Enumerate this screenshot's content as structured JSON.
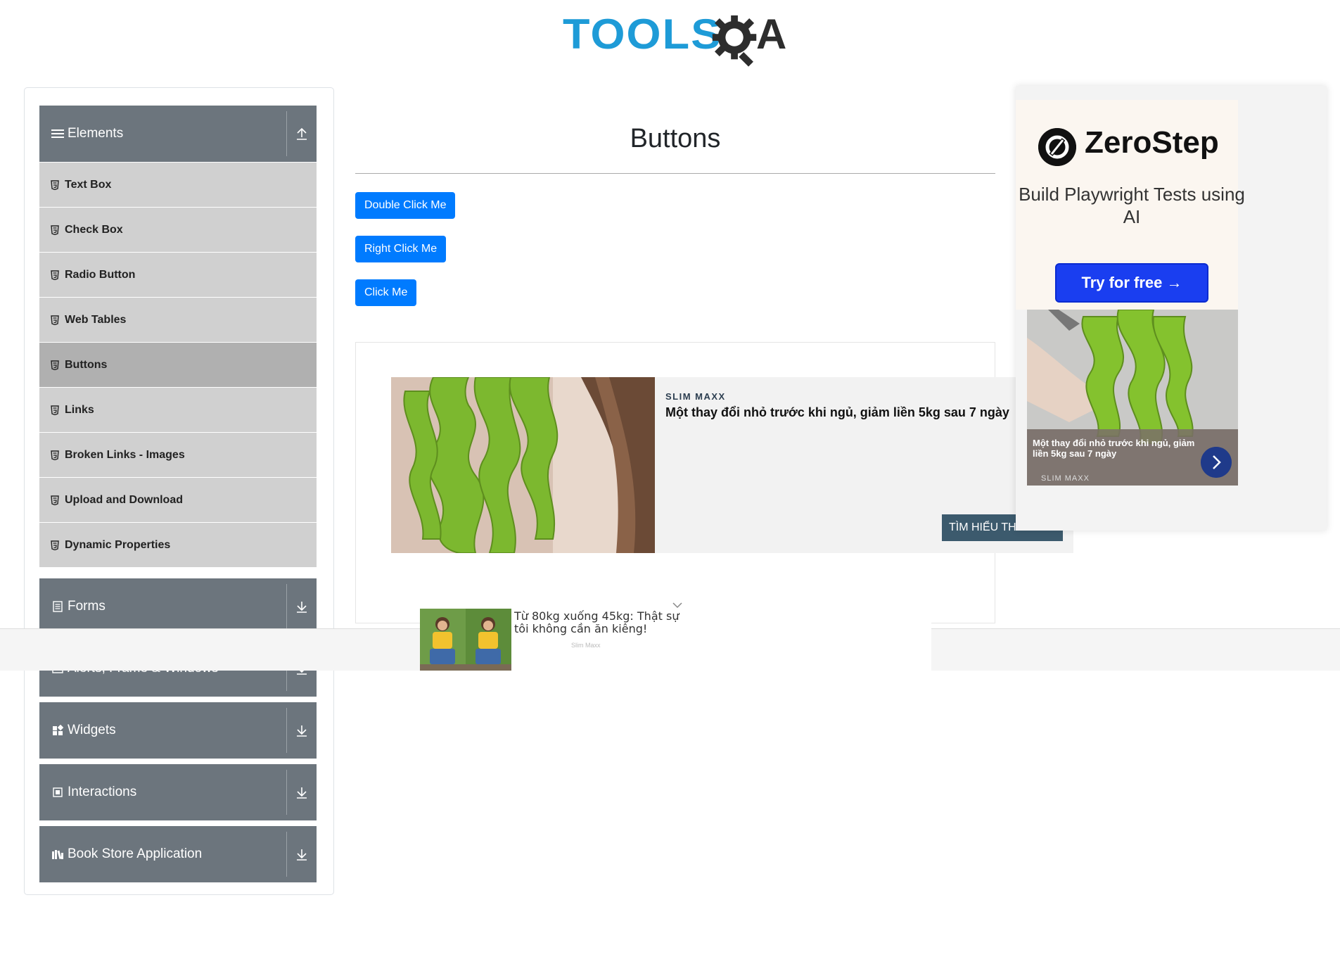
{
  "logo": {
    "text": "TOOLS",
    "text2": "A"
  },
  "sidebar": {
    "groups": [
      {
        "label": "Elements",
        "icon": "menu-icon",
        "expanded": true
      },
      {
        "label": "Forms",
        "icon": "form-icon"
      },
      {
        "label": "Alerts, Frame & Windows",
        "icon": "window-icon"
      },
      {
        "label": "Widgets",
        "icon": "widgets-icon"
      },
      {
        "label": "Interactions",
        "icon": "interactions-icon"
      },
      {
        "label": "Book Store Application",
        "icon": "book-icon"
      }
    ],
    "items": [
      {
        "label": "Text Box"
      },
      {
        "label": "Check Box"
      },
      {
        "label": "Radio Button"
      },
      {
        "label": "Web Tables"
      },
      {
        "label": "Buttons",
        "active": true
      },
      {
        "label": "Links"
      },
      {
        "label": "Broken Links - Images"
      },
      {
        "label": "Upload and Download"
      },
      {
        "label": "Dynamic Properties"
      }
    ]
  },
  "main": {
    "title": "Buttons",
    "buttons": {
      "double_click": "Double Click Me",
      "right_click": "Right Click Me",
      "click": "Click Me"
    }
  },
  "ad_main": {
    "brand": "SLIM MAXX",
    "headline": "Một thay đổi nhỏ trước khi ngủ, giảm liền 5kg sau 7 ngày",
    "cta": "TÌM HIỂU THÊM"
  },
  "ad_right": {
    "name": "ZeroStep",
    "tagline": "Build Playwright Tests using AI",
    "cta": "Try for free →",
    "promo_text": "Một thay đổi nhỏ trước khi ngủ, giảm liền 5kg sau 7 ngày",
    "promo_brand": "SLIM MAXX"
  },
  "ad_sticky": {
    "title": "Từ 80kg xuống 45kg: Thật sự tôi không cần ăn kiêng!",
    "brand": "Slim Maxx"
  },
  "colors": {
    "primary": "#007bff",
    "sidebar_header": "#6c757d",
    "logo_blue": "#1e9bd7"
  }
}
